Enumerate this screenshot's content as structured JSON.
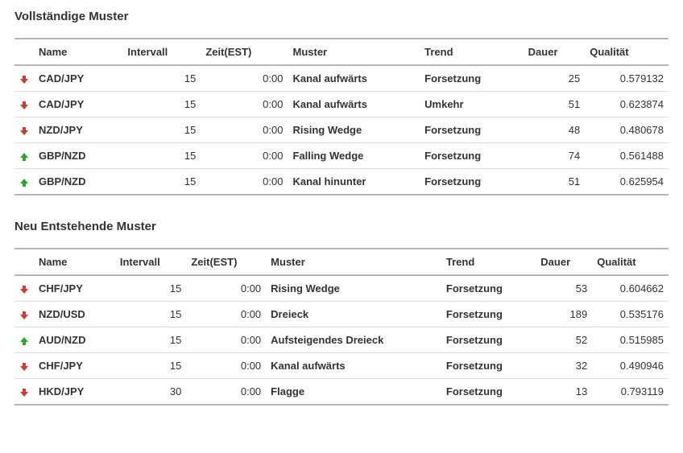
{
  "sections": [
    {
      "title": "Vollständige Muster",
      "columns": [
        "Name",
        "Intervall",
        "Zeit(EST)",
        "Muster",
        "Trend",
        "Dauer",
        "Qualität"
      ],
      "rows": [
        {
          "dir": "down",
          "name": "CAD/JPY",
          "interval": "15",
          "time": "0:00",
          "pattern": "Kanal aufwärts",
          "trend": "Forsetzung",
          "duration": "25",
          "quality": "0.579132"
        },
        {
          "dir": "down",
          "name": "CAD/JPY",
          "interval": "15",
          "time": "0:00",
          "pattern": "Kanal aufwärts",
          "trend": "Umkehr",
          "duration": "51",
          "quality": "0.623874"
        },
        {
          "dir": "down",
          "name": "NZD/JPY",
          "interval": "15",
          "time": "0:00",
          "pattern": "Rising Wedge",
          "trend": "Forsetzung",
          "duration": "48",
          "quality": "0.480678"
        },
        {
          "dir": "up",
          "name": "GBP/NZD",
          "interval": "15",
          "time": "0:00",
          "pattern": "Falling Wedge",
          "trend": "Forsetzung",
          "duration": "74",
          "quality": "0.561488"
        },
        {
          "dir": "up",
          "name": "GBP/NZD",
          "interval": "15",
          "time": "0:00",
          "pattern": "Kanal hinunter",
          "trend": "Forsetzung",
          "duration": "51",
          "quality": "0.625954"
        }
      ]
    },
    {
      "title": "Neu Entstehende Muster",
      "columns": [
        "Name",
        "Intervall",
        "Zeit(EST)",
        "Muster",
        "Trend",
        "Dauer",
        "Qualität"
      ],
      "rows": [
        {
          "dir": "down",
          "name": "CHF/JPY",
          "interval": "15",
          "time": "0:00",
          "pattern": "Rising Wedge",
          "trend": "Forsetzung",
          "duration": "53",
          "quality": "0.604662"
        },
        {
          "dir": "down",
          "name": "NZD/USD",
          "interval": "15",
          "time": "0:00",
          "pattern": "Dreieck",
          "trend": "Forsetzung",
          "duration": "189",
          "quality": "0.535176"
        },
        {
          "dir": "up",
          "name": "AUD/NZD",
          "interval": "15",
          "time": "0:00",
          "pattern": "Aufsteigendes Dreieck",
          "trend": "Forsetzung",
          "duration": "52",
          "quality": "0.515985"
        },
        {
          "dir": "down",
          "name": "CHF/JPY",
          "interval": "15",
          "time": "0:00",
          "pattern": "Kanal aufwärts",
          "trend": "Forsetzung",
          "duration": "32",
          "quality": "0.490946"
        },
        {
          "dir": "down",
          "name": "HKD/JPY",
          "interval": "30",
          "time": "0:00",
          "pattern": "Flagge",
          "trend": "Forsetzung",
          "duration": "13",
          "quality": "0.793119"
        }
      ]
    }
  ],
  "chart_data": {
    "type": "table",
    "tables": [
      {
        "title": "Vollständige Muster",
        "columns": [
          "Direction",
          "Name",
          "Intervall",
          "Zeit(EST)",
          "Muster",
          "Trend",
          "Dauer",
          "Qualität"
        ],
        "rows": [
          [
            "down",
            "CAD/JPY",
            15,
            "0:00",
            "Kanal aufwärts",
            "Forsetzung",
            25,
            0.579132
          ],
          [
            "down",
            "CAD/JPY",
            15,
            "0:00",
            "Kanal aufwärts",
            "Umkehr",
            51,
            0.623874
          ],
          [
            "down",
            "NZD/JPY",
            15,
            "0:00",
            "Rising Wedge",
            "Forsetzung",
            48,
            0.480678
          ],
          [
            "up",
            "GBP/NZD",
            15,
            "0:00",
            "Falling Wedge",
            "Forsetzung",
            74,
            0.561488
          ],
          [
            "up",
            "GBP/NZD",
            15,
            "0:00",
            "Kanal hinunter",
            "Forsetzung",
            51,
            0.625954
          ]
        ]
      },
      {
        "title": "Neu Entstehende Muster",
        "columns": [
          "Direction",
          "Name",
          "Intervall",
          "Zeit(EST)",
          "Muster",
          "Trend",
          "Dauer",
          "Qualität"
        ],
        "rows": [
          [
            "down",
            "CHF/JPY",
            15,
            "0:00",
            "Rising Wedge",
            "Forsetzung",
            53,
            0.604662
          ],
          [
            "down",
            "NZD/USD",
            15,
            "0:00",
            "Dreieck",
            "Forsetzung",
            189,
            0.535176
          ],
          [
            "up",
            "AUD/NZD",
            15,
            "0:00",
            "Aufsteigendes Dreieck",
            "Forsetzung",
            52,
            0.515985
          ],
          [
            "down",
            "CHF/JPY",
            15,
            "0:00",
            "Kanal aufwärts",
            "Forsetzung",
            32,
            0.490946
          ],
          [
            "down",
            "HKD/JPY",
            30,
            "0:00",
            "Flagge",
            "Forsetzung",
            13,
            0.793119
          ]
        ]
      }
    ]
  }
}
